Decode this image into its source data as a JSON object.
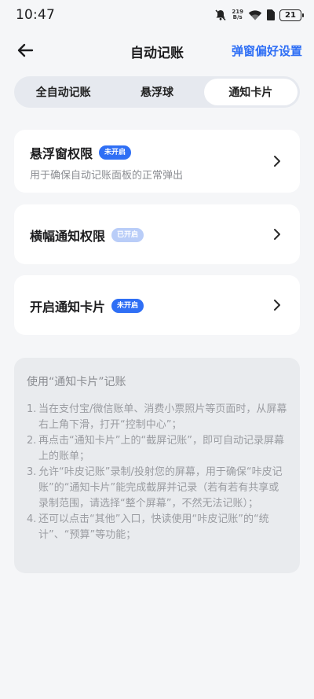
{
  "status_bar": {
    "time": "10:47",
    "speed_value": "219",
    "speed_unit": "B/s",
    "battery": "21"
  },
  "nav": {
    "title": "自动记账",
    "action": "弹窗偏好设置"
  },
  "tabs": [
    {
      "label": "全自动记账",
      "active": false
    },
    {
      "label": "悬浮球",
      "active": false
    },
    {
      "label": "通知卡片",
      "active": true
    }
  ],
  "cards": [
    {
      "title": "悬浮窗权限",
      "badge": "未开启",
      "desc": "用于确保自动记账面板的正常弹出"
    },
    {
      "title": "横幅通知权限",
      "badge": "已开启"
    },
    {
      "title": "开启通知卡片",
      "badge": "未开启"
    }
  ],
  "info": {
    "title": "使用“通知卡片”记账",
    "items": [
      {
        "num": "1.",
        "text": "当在支付宝/微信账单、消费小票照片等页面时，从屏幕右上角下滑，打开“控制中心”；"
      },
      {
        "num": "2.",
        "text": "再点击“通知卡片”上的“截屏记账”，即可自动记录屏幕上的账单；"
      },
      {
        "num": "3.",
        "text": "允许“咔皮记账”录制/投射您的屏幕，用于确保“咔皮记账”的“通知卡片”能完成截屏并记录（若有若有共享或录制范围，请选择“整个屏幕”，不然无法记账）；"
      },
      {
        "num": "4.",
        "text": "还可以点击“其他”入口，快读使用“咔皮记账”的“统计”、“预算”等功能；"
      }
    ]
  },
  "colors": {
    "accent": "#2f6ff5",
    "badge_off": "#b9cdf8",
    "background": "#f5f6f8"
  }
}
